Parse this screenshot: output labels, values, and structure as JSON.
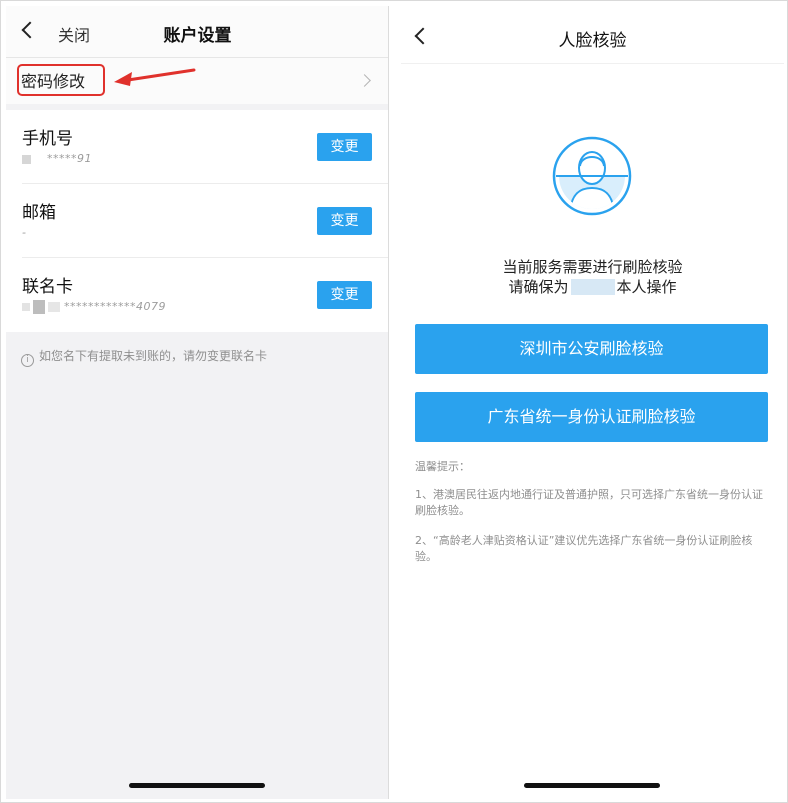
{
  "left": {
    "nav": {
      "close_label": "关闭",
      "title": "账户设置"
    },
    "password_row": {
      "label": "密码修改"
    },
    "items": [
      {
        "label": "手机号",
        "value": "*****91",
        "button": "变更"
      },
      {
        "label": "邮箱",
        "value": "-",
        "button": "变更"
      },
      {
        "label": "联名卡",
        "value": "************4079",
        "button": "变更"
      }
    ],
    "notice": "如您名下有提取未到账的，请勿变更联名卡"
  },
  "right": {
    "nav": {
      "title": "人脸核验"
    },
    "service_text": {
      "line1": "当前服务需要进行刷脸核验",
      "line2_prefix": "请确保为",
      "line2_suffix": "本人操作"
    },
    "buttons": [
      {
        "label": "深圳市公安刷脸核验"
      },
      {
        "label": "广东省统一身份认证刷脸核验"
      }
    ],
    "tips_title": "温馨提示：",
    "tips": [
      "1、港澳居民往返内地通行证及普通护照，只可选择广东省统一身份认证刷脸核验。",
      "2、“高龄老人津贴资格认证”建议优先选择广东省统一身份认证刷脸核验。"
    ]
  },
  "colors": {
    "accent": "#2aa2ee",
    "annotation_red": "#e0312c",
    "page_bg": "#f2f2f4"
  },
  "icons": {
    "back": "chevron-left-icon",
    "row_arrow": "chevron-right-icon",
    "info": "info-circle-icon",
    "face": "face-scan-icon"
  }
}
